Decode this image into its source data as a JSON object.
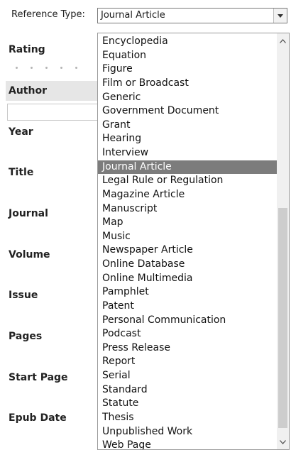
{
  "reference_type": {
    "label": "Reference Type:",
    "value": "Journal Article"
  },
  "fields": [
    "Rating",
    "Author",
    "Year",
    "Title",
    "Journal",
    "Volume",
    "Issue",
    "Pages",
    "Start Page",
    "Epub Date"
  ],
  "dropdown": {
    "selected": "Journal Article",
    "options": [
      "Encyclopedia",
      "Equation",
      "Figure",
      "Film or Broadcast",
      "Generic",
      "Government Document",
      "Grant",
      "Hearing",
      "Interview",
      "Journal Article",
      "Legal Rule or Regulation",
      "Magazine Article",
      "Manuscript",
      "Map",
      "Music",
      "Newspaper Article",
      "Online Database",
      "Online Multimedia",
      "Pamphlet",
      "Patent",
      "Personal Communication",
      "Podcast",
      "Press Release",
      "Report",
      "Serial",
      "Standard",
      "Statute",
      "Thesis",
      "Unpublished Work",
      "Web Page"
    ]
  },
  "colors": {
    "selected_bg": "#7c7c7c",
    "border": "#9a9a9a"
  },
  "icons": {
    "select_arrow": "caret-down-icon",
    "scroll_up": "chevron-up-icon",
    "scroll_down": "chevron-down-icon"
  }
}
